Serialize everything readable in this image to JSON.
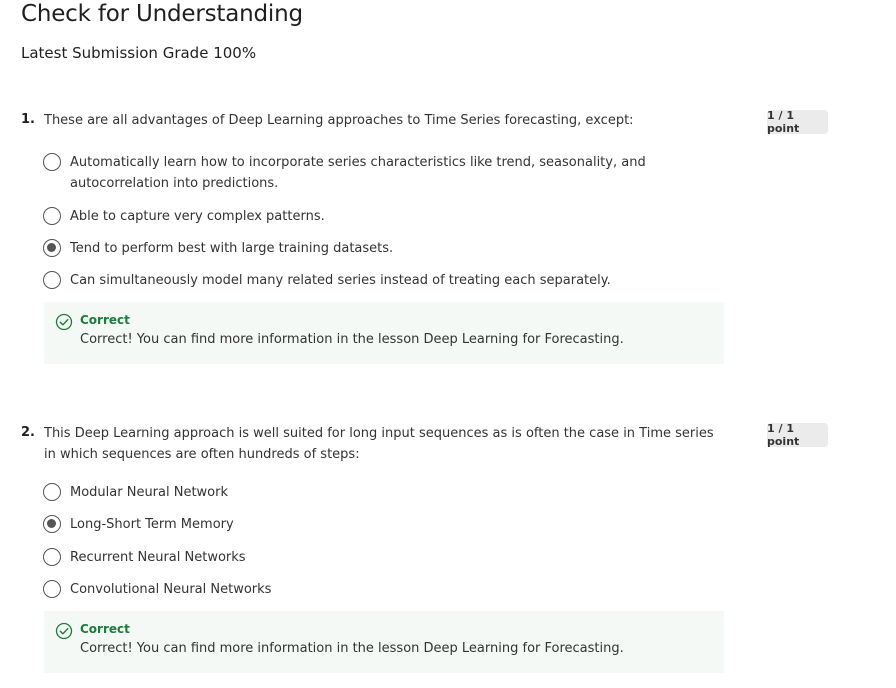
{
  "page": {
    "title": "Check for Understanding",
    "grade": "Latest Submission Grade 100%"
  },
  "questions": [
    {
      "number": "1.",
      "text": "These are all advantages of Deep Learning approaches to Time Series forecasting, except:",
      "points": "1 / 1 point",
      "options": [
        {
          "label": "Automatically learn how to incorporate series characteristics like trend, seasonality, and autocorrelation into predictions.",
          "selected": false
        },
        {
          "label": "Able to capture very complex patterns.",
          "selected": false
        },
        {
          "label": "Tend to perform best with large training datasets.",
          "selected": true
        },
        {
          "label": "Can simultaneously model many related series instead of treating each separately.",
          "selected": false
        }
      ],
      "feedback": {
        "status": "Correct",
        "message": "Correct! You can find more information in the lesson Deep Learning for Forecasting."
      }
    },
    {
      "number": "2.",
      "text": "This Deep Learning approach is well suited for long input sequences as is often the case in Time series in which sequences are often hundreds of steps:",
      "points": "1 / 1 point",
      "options": [
        {
          "label": "Modular Neural Network",
          "selected": false
        },
        {
          "label": "Long-Short Term Memory",
          "selected": true
        },
        {
          "label": "Recurrent Neural Networks",
          "selected": false
        },
        {
          "label": "Convolutional Neural Networks",
          "selected": false
        }
      ],
      "feedback": {
        "status": "Correct",
        "message": "Correct! You can find more information in the lesson Deep Learning for Forecasting."
      }
    }
  ],
  "colors": {
    "correct_green": "#1e7b3c",
    "feedback_bg": "#f4f9f5",
    "points_bg": "#ebebeb"
  }
}
